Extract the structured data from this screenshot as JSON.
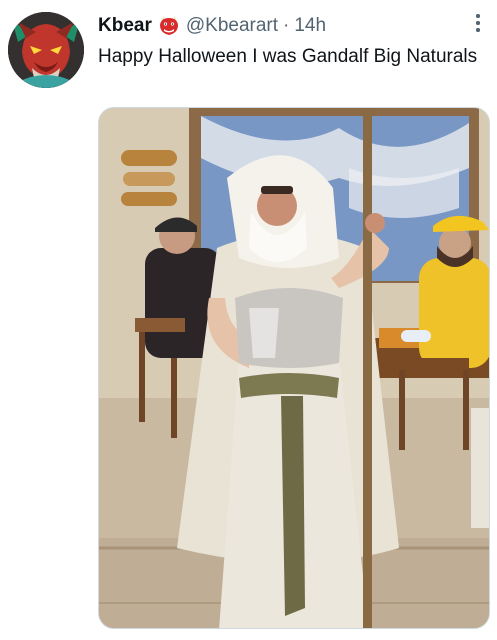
{
  "tweet": {
    "author": {
      "display_name": "Kbear",
      "name_emoji": "ogre-emoji",
      "handle": "@Kbearart",
      "separator": "·",
      "time": "14h",
      "avatar": "devil-character-avatar"
    },
    "text": "Happy Halloween I was Gandalf Big Naturals",
    "more_icon": "more-vertical-icon",
    "media": {
      "type": "photo"
    }
  },
  "colors": {
    "text_primary": "#0f1419",
    "text_secondary": "#536471",
    "media_border": "#cfd9de"
  }
}
